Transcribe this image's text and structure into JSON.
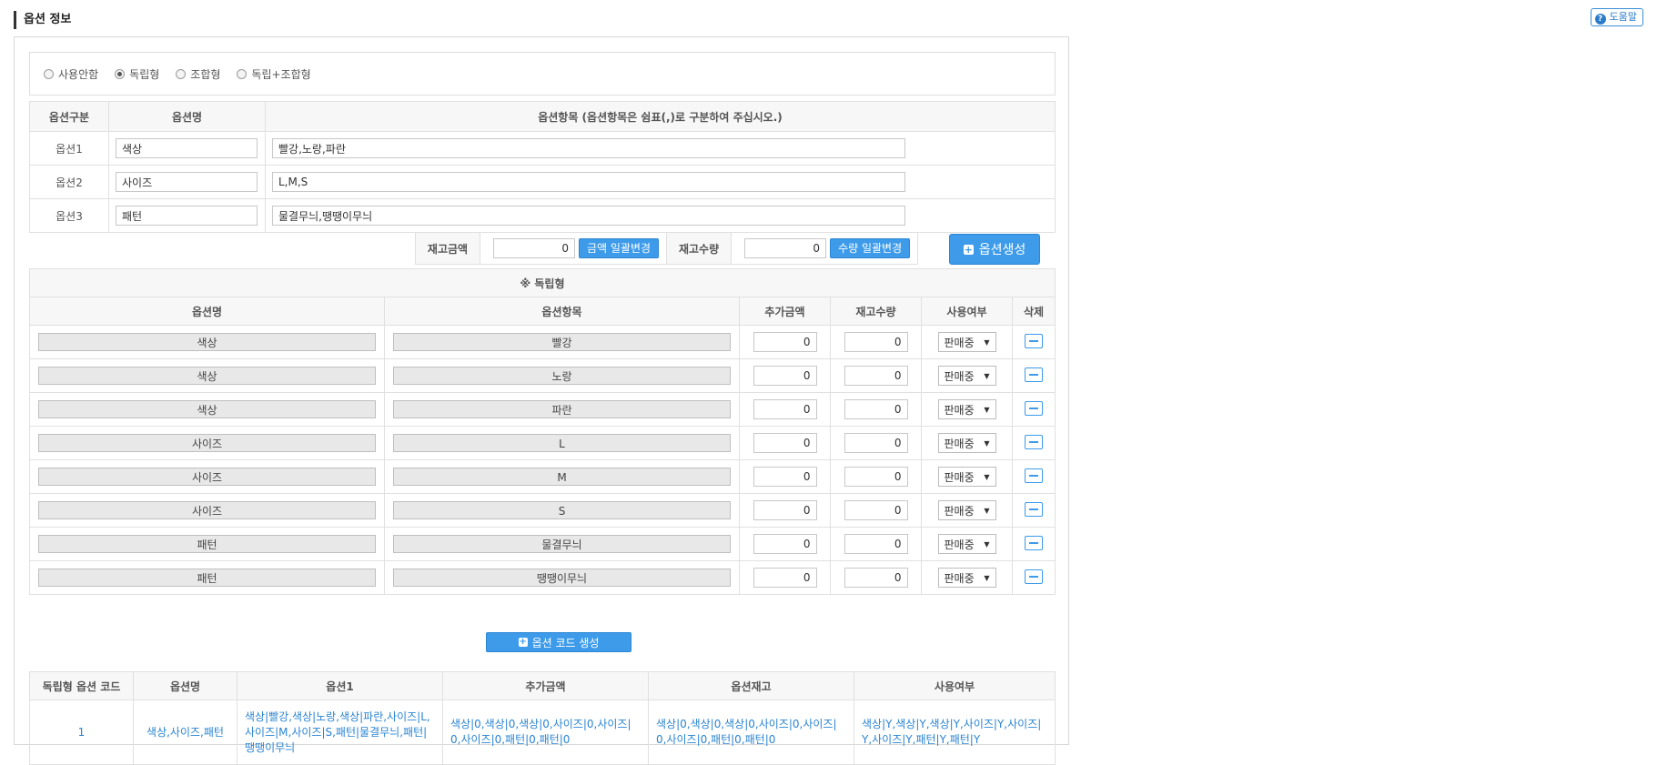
{
  "page": {
    "title": "옵션 정보",
    "help_label": "도움말"
  },
  "option_types": [
    {
      "label": "사용안함",
      "checked": false
    },
    {
      "label": "독립형",
      "checked": true
    },
    {
      "label": "조합형",
      "checked": false
    },
    {
      "label": "독립+조합형",
      "checked": false
    }
  ],
  "option_definition": {
    "headers": [
      "옵션구분",
      "옵션명",
      "옵션항목 (옵션항목은 쉼표(,)로 구분하여 주십시오.)"
    ],
    "rows": [
      {
        "category": "옵션1",
        "name": "색상",
        "items": "빨강,노랑,파란"
      },
      {
        "category": "옵션2",
        "name": "사이즈",
        "items": "L,M,S"
      },
      {
        "category": "옵션3",
        "name": "패턴",
        "items": "물결무늬,땡땡이무늬"
      }
    ]
  },
  "bulk_edit": {
    "price_label": "재고금액",
    "price_value": "0",
    "price_button": "금액 일괄변경",
    "qty_label": "재고수량",
    "qty_value": "0",
    "qty_button": "수량 일괄변경"
  },
  "generate_button": "옵션생성",
  "option_list": {
    "section_title": "※ 독립형",
    "headers": [
      "옵션명",
      "옵션항목",
      "추가금액",
      "재고수량",
      "사용여부",
      "삭제"
    ],
    "rows": [
      {
        "name": "색상",
        "item": "빨강",
        "price": "0",
        "stock": "0",
        "status": "판매중"
      },
      {
        "name": "색상",
        "item": "노랑",
        "price": "0",
        "stock": "0",
        "status": "판매중"
      },
      {
        "name": "색상",
        "item": "파란",
        "price": "0",
        "stock": "0",
        "status": "판매중"
      },
      {
        "name": "사이즈",
        "item": "L",
        "price": "0",
        "stock": "0",
        "status": "판매중"
      },
      {
        "name": "사이즈",
        "item": "M",
        "price": "0",
        "stock": "0",
        "status": "판매중"
      },
      {
        "name": "사이즈",
        "item": "S",
        "price": "0",
        "stock": "0",
        "status": "판매중"
      },
      {
        "name": "패턴",
        "item": "물결무늬",
        "price": "0",
        "stock": "0",
        "status": "판매중"
      },
      {
        "name": "패턴",
        "item": "땡땡이무늬",
        "price": "0",
        "stock": "0",
        "status": "판매중"
      }
    ]
  },
  "code_button": "옵션 코드 생성",
  "code_table": {
    "headers": [
      "독립형 옵션 코드",
      "옵션명",
      "옵션1",
      "추가금액",
      "옵션재고",
      "사용여부"
    ],
    "rows": [
      {
        "code": "1",
        "name": "색상,사이즈,패턴",
        "option1": "색상|빨강,색상|노랑,색상|파란,사이즈|L,사이즈|M,사이즈|S,패턴|물결무늬,패턴|땡땡이무늬",
        "price": "색상|0,색상|0,색상|0,사이즈|0,사이즈|0,사이즈|0,패턴|0,패턴|0",
        "stock": "색상|0,색상|0,색상|0,사이즈|0,사이즈|0,사이즈|0,패턴|0,패턴|0",
        "usage": "색상|Y,색상|Y,색상|Y,사이즈|Y,사이즈|Y,사이즈|Y,패턴|Y,패턴|Y"
      }
    ]
  },
  "colors": {
    "accent": "#3d9be9",
    "link_text": "#2a84d2",
    "header_bg": "#f7f7f7",
    "readonly_bg": "#e8e8e8"
  }
}
